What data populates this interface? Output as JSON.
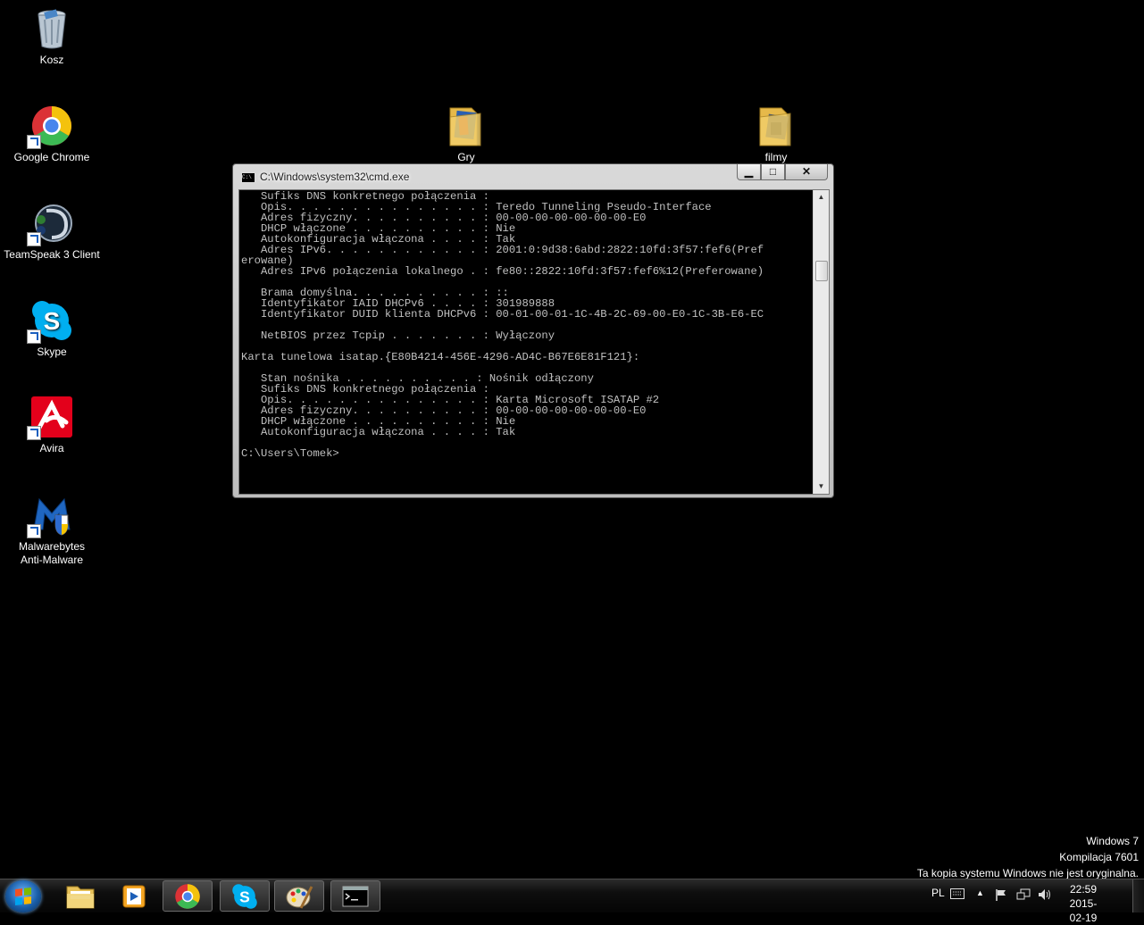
{
  "desktop": {
    "icons": [
      {
        "label": "Kosz",
        "icon": "recycle-bin-icon"
      },
      {
        "label": "Google Chrome",
        "icon": "chrome-icon"
      },
      {
        "label": "TeamSpeak 3 Client",
        "icon": "teamspeak-icon"
      },
      {
        "label": "Skype",
        "icon": "skype-icon"
      },
      {
        "label": "Avira",
        "icon": "avira-icon"
      },
      {
        "label": "Malwarebytes Anti-Malware",
        "icon": "malwarebytes-icon"
      },
      {
        "label": "Gry",
        "icon": "folder-icon"
      },
      {
        "label": "filmy",
        "icon": "folder-icon"
      }
    ]
  },
  "cmd": {
    "title": "C:\\Windows\\system32\\cmd.exe",
    "icon_text": "C:\\",
    "buttons": {
      "minimize": "▁",
      "maximize": "□",
      "close": "✕"
    },
    "output": "   Sufiks DNS konkretnego połączenia :\n   Opis. . . . . . . . . . . . . . . : Teredo Tunneling Pseudo-Interface\n   Adres fizyczny. . . . . . . . . . : 00-00-00-00-00-00-00-E0\n   DHCP włączone . . . . . . . . . . : Nie\n   Autokonfiguracja włączona . . . . : Tak\n   Adres IPv6. . . . . . . . . . . . : 2001:0:9d38:6abd:2822:10fd:3f57:fef6(Pref\nerowane)\n   Adres IPv6 połączenia lokalnego . : fe80::2822:10fd:3f57:fef6%12(Preferowane)\n\n   Brama domyślna. . . . . . . . . . : ::\n   Identyfikator IAID DHCPv6 . . . . : 301989888\n   Identyfikator DUID klienta DHCPv6 : 00-01-00-01-1C-4B-2C-69-00-E0-1C-3B-E6-EC\n\n   NetBIOS przez Tcpip . . . . . . . : Wyłączony\n\nKarta tunelowa isatap.{E80B4214-456E-4296-AD4C-B67E6E81F121}:\n\n   Stan nośnika . . . . . . . . . . : Nośnik odłączony\n   Sufiks DNS konkretnego połączenia :\n   Opis. . . . . . . . . . . . . . . : Karta Microsoft ISATAP #2\n   Adres fizyczny. . . . . . . . . . : 00-00-00-00-00-00-00-E0\n   DHCP włączone . . . . . . . . . . : Nie\n   Autokonfiguracja włączona . . . . : Tak\n\nC:\\Users\\Tomek>",
    "scrollbar": {
      "up": "▲",
      "down": "▼"
    }
  },
  "watermark": {
    "line1": "Windows 7",
    "line2": "Kompilacja 7601",
    "line3": "Ta kopia systemu Windows nie jest oryginalna."
  },
  "taskbar": {
    "items": [
      "explorer-icon",
      "media-player-icon",
      "chrome-icon",
      "skype-icon",
      "paint-icon",
      "cmd-icon"
    ],
    "tray": {
      "language": "PL",
      "time": "22:59",
      "date": "2015-02-19"
    }
  },
  "colors": {
    "console_text": "#c0c0c0",
    "console_bg": "#000000",
    "desktop_bg": "#000000"
  }
}
